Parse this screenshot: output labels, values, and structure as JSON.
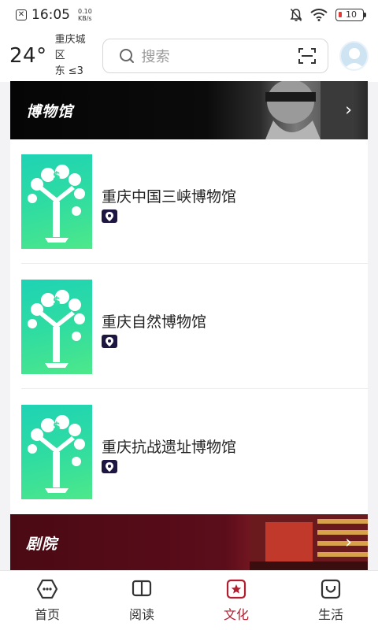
{
  "status_bar": {
    "time": "16:05",
    "speed_value": "0.10",
    "speed_unit": "KB/s",
    "battery": "10"
  },
  "header": {
    "temperature": "24°",
    "location": "重庆城区",
    "wind": "东  ≤3",
    "search_placeholder": "搜索"
  },
  "sections": {
    "museum_title": "博物馆",
    "theater_title": "剧院"
  },
  "museums": [
    {
      "name": "重庆中国三峡博物馆"
    },
    {
      "name": "重庆自然博物馆"
    },
    {
      "name": "重庆抗战遗址博物馆"
    }
  ],
  "bottom_nav": [
    {
      "label": "首页",
      "icon": "home-icon"
    },
    {
      "label": "阅读",
      "icon": "book-icon"
    },
    {
      "label": "文化",
      "icon": "culture-star-icon",
      "active": true
    },
    {
      "label": "生活",
      "icon": "life-icon"
    }
  ],
  "colors": {
    "accent": "#b01e2f",
    "thumb_green": "#2fdca1",
    "pin_bg": "#1c1640"
  }
}
